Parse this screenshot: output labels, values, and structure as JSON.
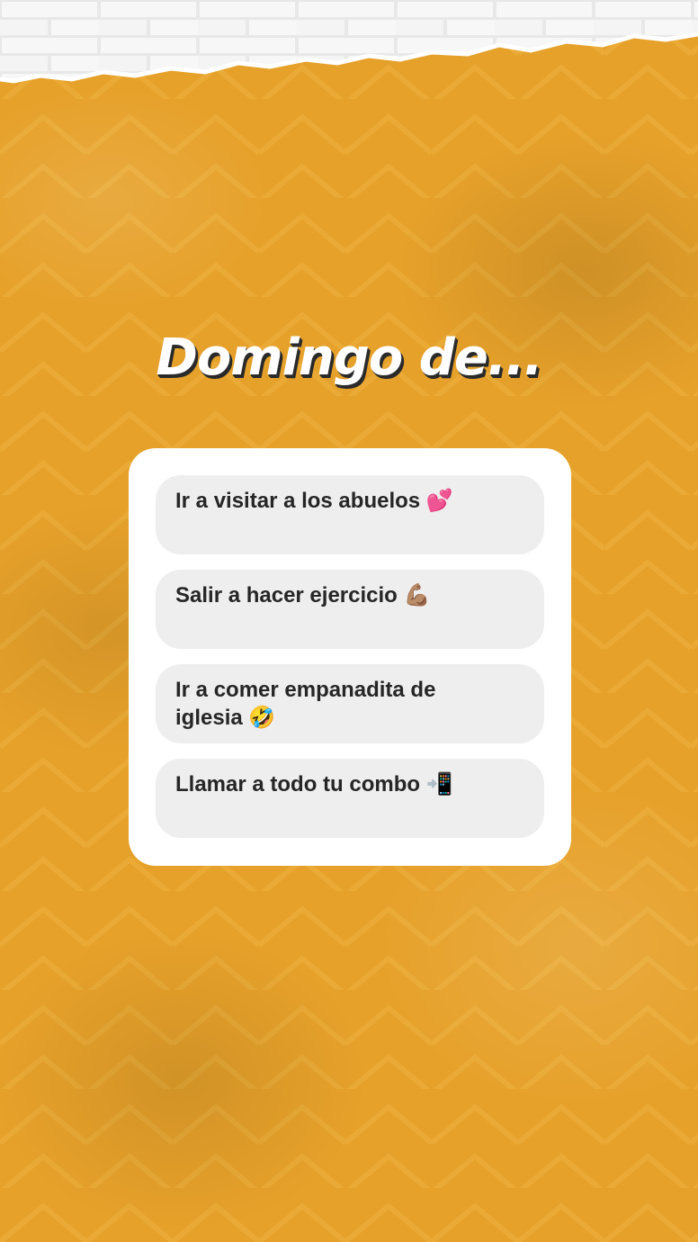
{
  "story": {
    "title": "Domingo de...",
    "background_color": "#E6A12A"
  },
  "quiz": {
    "options": [
      {
        "label": "Ir a visitar a los abuelos 💕"
      },
      {
        "label": "Salir a hacer ejercicio 💪🏽"
      },
      {
        "label": "Ir a comer empanadita de iglesia 🤣"
      },
      {
        "label": "Llamar a todo tu combo 📲"
      }
    ]
  }
}
